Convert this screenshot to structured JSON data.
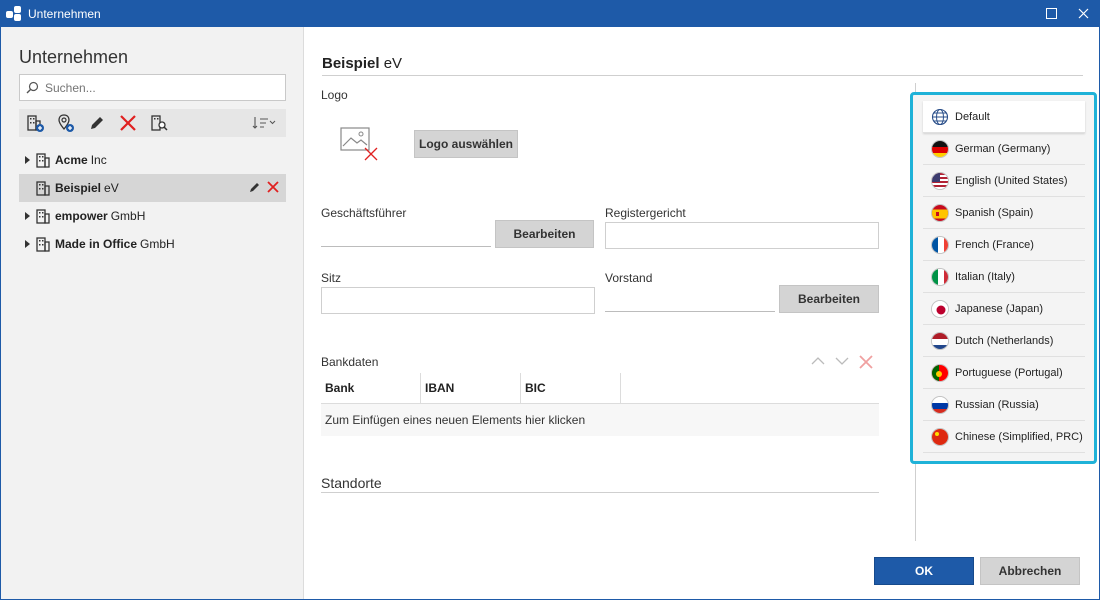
{
  "window": {
    "title": "Unternehmen",
    "maximize_icon": "maximize-icon",
    "close_icon": "close-icon"
  },
  "sidebar": {
    "heading": "Unternehmen",
    "search_placeholder": "Suchen...",
    "toolbar_icons": [
      "add-company-icon",
      "add-location-icon",
      "edit-icon",
      "delete-icon",
      "search-company-icon",
      "sort-icon"
    ],
    "items": [
      {
        "bold": "Acme",
        "rest": "Inc",
        "selected": false
      },
      {
        "bold": "Beispiel",
        "rest": "eV",
        "selected": true
      },
      {
        "bold": "empower",
        "rest": "GmbH",
        "selected": false
      },
      {
        "bold": "Made in Office",
        "rest": "GmbH",
        "selected": false
      }
    ]
  },
  "detail": {
    "title_bold": "Beispiel",
    "title_rest": "eV",
    "logo_label": "Logo",
    "logo_button": "Logo auswählen",
    "managing_director_label": "Geschäftsführer",
    "edit_button": "Bearbeiten",
    "register_court_label": "Registergericht",
    "seat_label": "Sitz",
    "board_label": "Vorstand",
    "board_edit_button": "Bearbeiten",
    "bank_label": "Bankdaten",
    "bank_columns": [
      "Bank",
      "IBAN",
      "BIC"
    ],
    "bank_new_row": "Zum Einfügen eines neuen Elements hier klicken",
    "locations_label": "Standorte"
  },
  "languages": [
    {
      "label": "Default",
      "icon": "globe-icon",
      "active": true
    },
    {
      "label": "German (Germany)",
      "icon": "flag-de-icon"
    },
    {
      "label": "English (United States)",
      "icon": "flag-us-icon"
    },
    {
      "label": "Spanish (Spain)",
      "icon": "flag-es-icon"
    },
    {
      "label": "French (France)",
      "icon": "flag-fr-icon"
    },
    {
      "label": "Italian (Italy)",
      "icon": "flag-it-icon"
    },
    {
      "label": "Japanese (Japan)",
      "icon": "flag-jp-icon"
    },
    {
      "label": "Dutch (Netherlands)",
      "icon": "flag-nl-icon"
    },
    {
      "label": "Portuguese (Portugal)",
      "icon": "flag-pt-icon"
    },
    {
      "label": "Russian (Russia)",
      "icon": "flag-ru-icon"
    },
    {
      "label": "Chinese (Simplified, PRC)",
      "icon": "flag-cn-icon"
    }
  ],
  "footer": {
    "ok_label": "OK",
    "cancel_label": "Abbrechen"
  },
  "colors": {
    "accent": "#1e5aa8",
    "highlight_border": "#1fb2d8",
    "delete_red": "#e02020"
  }
}
